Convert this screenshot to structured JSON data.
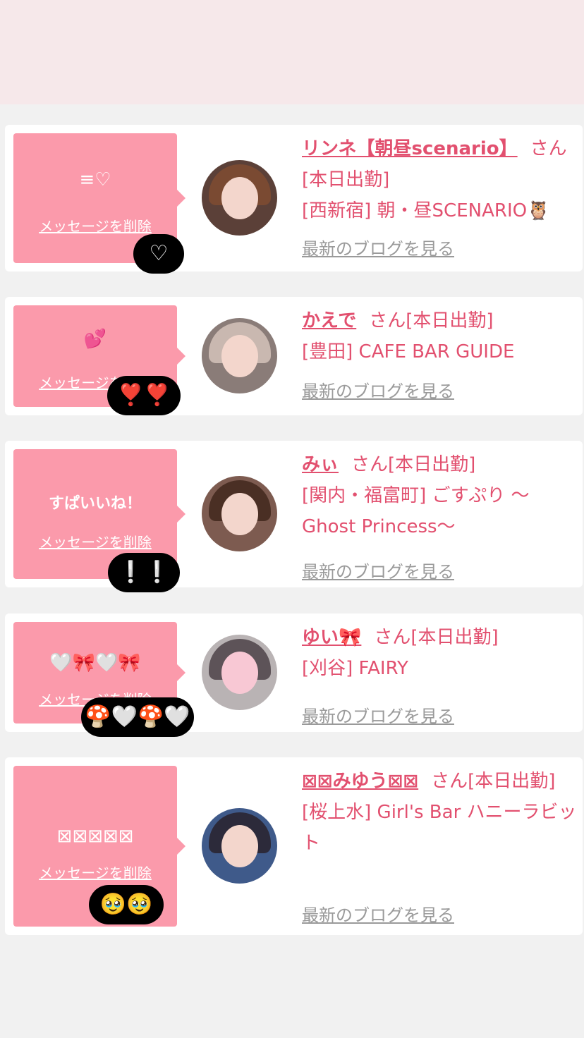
{
  "delete_label": "メッセージを削除",
  "blog_label": "最新のブログを見る",
  "items": [
    {
      "bubble_message": "≡♡",
      "reaction": "♡",
      "cast_name": "リンネ【朝昼scenario】",
      "name_suffix": "さん[本日出勤]",
      "shop": "[西新宿] 朝・昼SCENARIO🦉",
      "avatar_hair": "#7a4a32",
      "avatar_bg": "#5b4038"
    },
    {
      "bubble_message": "💕",
      "reaction": "❣️❣️",
      "cast_name": "かえで",
      "name_suffix": "さん[本日出勤]",
      "shop": "[豊田] CAFE BAR GUIDE",
      "avatar_hair": "#c9b8b0",
      "avatar_bg": "#8a7c78"
    },
    {
      "bubble_message": "すぱいいね！",
      "reaction": "❕❕",
      "cast_name": "みぃ",
      "name_suffix": "さん[本日出勤]",
      "shop": "[関内・福富町] ごすぷり 〜Ghost Princess〜",
      "avatar_hair": "#4a2f24",
      "avatar_bg": "#7d5b50"
    },
    {
      "bubble_message": "🤍🎀🤍🎀",
      "reaction": "🍄🤍🍄🤍",
      "cast_name": "ゆい🎀",
      "name_suffix": "さん[本日出勤]",
      "shop": "[刈谷] FAIRY",
      "avatar_hair": "#5d5358",
      "avatar_bg": "#b9b3b4"
    },
    {
      "bubble_message": "⊠⊠⊠⊠⊠",
      "reaction": "🥹🥹",
      "cast_name": "⊠⊠みゆう⊠⊠",
      "name_suffix": "さん[本日出勤]",
      "shop": "[桜上水] Girl's Bar ハニーラビット",
      "avatar_hair": "#2c2a3a",
      "avatar_bg": "#3f5a8a"
    }
  ]
}
